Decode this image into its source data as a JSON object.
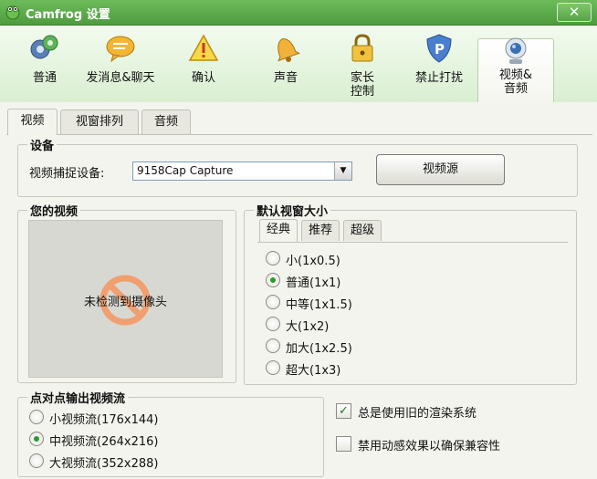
{
  "window": {
    "title": "Camfrog 设置",
    "close_glyph": "✕"
  },
  "toolbar": {
    "items": [
      {
        "label": "普通",
        "icon": "gears-icon"
      },
      {
        "label": "发消息&聊天",
        "icon": "chat-bubble-icon"
      },
      {
        "label": "确认",
        "icon": "warning-icon"
      },
      {
        "label": "声音",
        "icon": "bell-icon"
      },
      {
        "label_line1": "家长",
        "label_line2": "控制",
        "icon": "lock-icon"
      },
      {
        "label": "禁止打扰",
        "icon": "shield-icon"
      },
      {
        "label_line1": "视频&",
        "label_line2": "音频",
        "icon": "webcam-icon",
        "selected": true
      }
    ]
  },
  "tabs": {
    "video": "视频",
    "window_layout": "视窗排列",
    "audio": "音频",
    "selected": "视频"
  },
  "device": {
    "title": "设备",
    "capture_label": "视频捕捉设备:",
    "capture_value": "9158Cap Capture",
    "source_button": "视频源"
  },
  "your_video": {
    "title": "您的视频",
    "no_camera": "未检测到摄像头"
  },
  "default_size": {
    "title": "默认视窗大小",
    "tabs": [
      "经典",
      "推荐",
      "超级"
    ],
    "selected_tab": "经典",
    "options": [
      "小(1x0.5)",
      "普通(1x1)",
      "中等(1x1.5)",
      "大(1x2)",
      "加大(1x2.5)",
      "超大(1x3)"
    ],
    "selected": "普通(1x1)"
  },
  "p2p": {
    "title": "点对点输出视频流",
    "options": [
      "小视频流(176x144)",
      "中视频流(264x216)",
      "大视频流(352x288)"
    ],
    "selected": "中视频流(264x216)"
  },
  "checkboxes": [
    {
      "label": "总是使用旧的渲染系统",
      "checked": true
    },
    {
      "label": "禁用动感效果以确保兼容性",
      "checked": false
    }
  ],
  "colors": {
    "title_bar": "#4e9c3e",
    "accent_green": "#2b9b2b",
    "background": "#f4f4ee"
  }
}
